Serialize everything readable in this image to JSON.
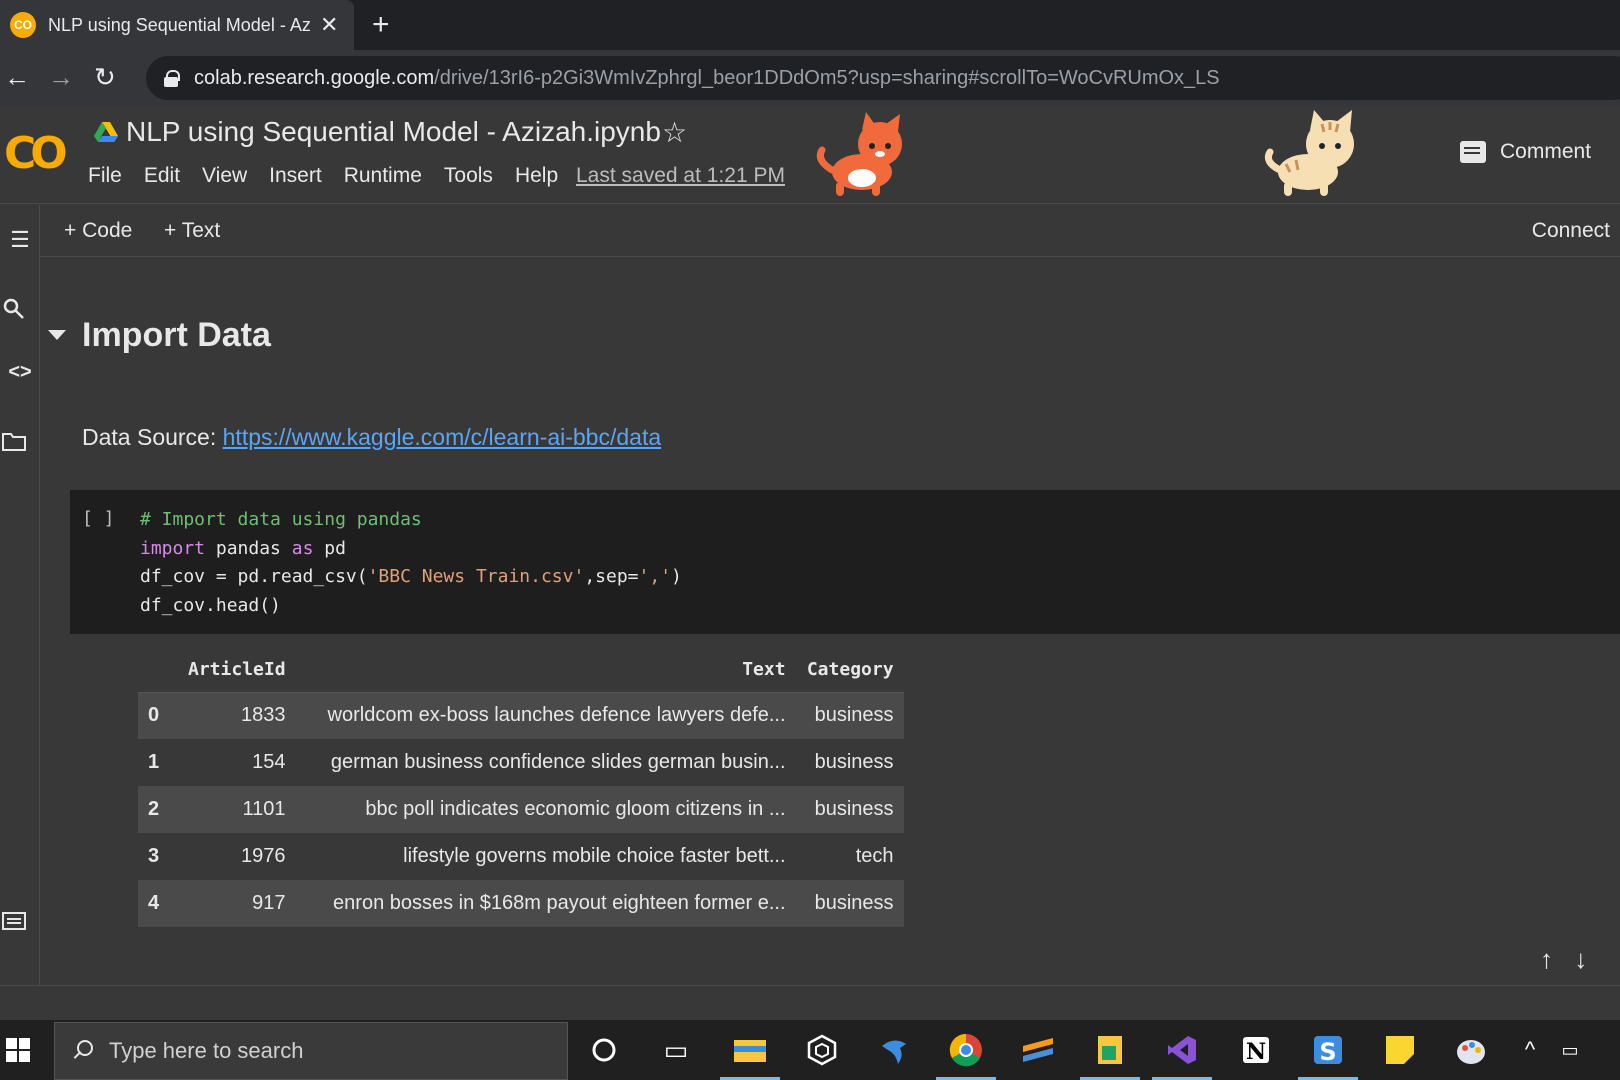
{
  "browser": {
    "tab_title": "NLP using Sequential Model - Az",
    "tab_close": "✕",
    "new_tab": "+",
    "url_host": "colab.research.google.com",
    "url_path": "/drive/13rI6-p2Gi3WmIvZphrgl_beor1DDdOm5?usp=sharing#scrollTo=WoCvRUmOx_LS"
  },
  "notebook": {
    "title": "NLP using Sequential Model - Azizah.ipynb",
    "menu": [
      "File",
      "Edit",
      "View",
      "Insert",
      "Runtime",
      "Tools",
      "Help"
    ],
    "last_saved": "Last saved at 1:21 PM",
    "comment_label": "Comment",
    "add_code": "+ Code",
    "add_text": "+ Text",
    "connect": "Connect"
  },
  "content": {
    "section_title": "Import Data",
    "source_label": "Data Source:",
    "source_link": "https://www.kaggle.com/c/learn-ai-bbc/data",
    "run_bracket": "[ ]",
    "code_lines": [
      "# Import data using pandas",
      "import pandas as pd",
      "df_cov = pd.read_csv('BBC News Train.csv',sep=',')",
      "df_cov.head()"
    ],
    "table": {
      "columns": [
        "",
        "ArticleId",
        "Text",
        "Category"
      ],
      "rows": [
        [
          "0",
          "1833",
          "worldcom ex-boss launches defence lawyers defe...",
          "business"
        ],
        [
          "1",
          "154",
          "german business confidence slides german busin...",
          "business"
        ],
        [
          "2",
          "1101",
          "bbc poll indicates economic gloom citizens in ...",
          "business"
        ],
        [
          "3",
          "1976",
          "lifestyle governs mobile choice faster bett...",
          "tech"
        ],
        [
          "4",
          "917",
          "enron bosses in $168m payout eighteen former e...",
          "business"
        ]
      ]
    }
  },
  "taskbar": {
    "search_placeholder": "Type here to search"
  },
  "colors": {
    "colab_orange": "#f9ab00",
    "link_blue": "#5aa6f4",
    "code_bg": "#1e1e1e",
    "page_bg": "#383838"
  }
}
